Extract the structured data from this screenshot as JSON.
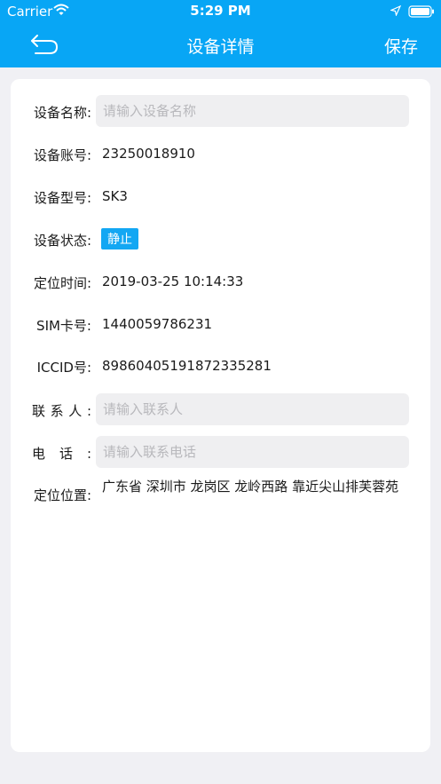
{
  "status_bar": {
    "carrier": "Carrier",
    "time": "5:29 PM",
    "wifi_icon": "wifi-icon",
    "location_icon": "location-arrow-icon",
    "battery_icon": "battery-icon"
  },
  "nav": {
    "back_icon": "back-arrow-icon",
    "title": "设备详情",
    "save_label": "保存"
  },
  "colors": {
    "header_bg": "#08a6f5",
    "page_bg": "#f0f0f4",
    "badge_bg": "#13a7f3"
  },
  "form": {
    "device_name": {
      "label": "设备名称:",
      "value": "",
      "placeholder": "请输入设备名称"
    },
    "device_account": {
      "label": "设备账号:",
      "value": "23250018910"
    },
    "device_model": {
      "label": "设备型号:",
      "value": "SK3"
    },
    "device_status": {
      "label": "设备状态:",
      "value": "静止"
    },
    "locate_time": {
      "label": "定位时间:",
      "value": "2019-03-25 10:14:33"
    },
    "sim_number": {
      "label": "SIM卡号:",
      "value": "1440059786231"
    },
    "iccid": {
      "label": "ICCID号:",
      "value": "89860405191872335281"
    },
    "contact": {
      "label": "联系人:",
      "value": "",
      "placeholder": "请输入联系人"
    },
    "phone": {
      "label": "电话:",
      "value": "",
      "placeholder": "请输入联系电话"
    },
    "location": {
      "label": "定位位置:",
      "value": "广东省 深圳市 龙岗区 龙岭西路 靠近尖山排芙蓉苑"
    }
  }
}
